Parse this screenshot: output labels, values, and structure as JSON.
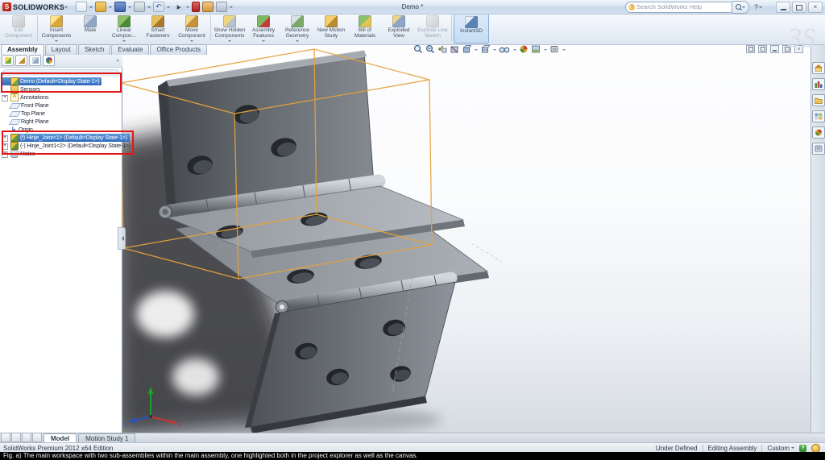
{
  "window": {
    "brand": "SOLIDWORKS",
    "title": "Demo *",
    "search_placeholder": "Search SolidWorks Help",
    "watermark": "3S"
  },
  "quick_access": {
    "icons": [
      "new-document",
      "open",
      "save",
      "print",
      "undo",
      "select-cursor",
      "rebuild",
      "options",
      "file-properties"
    ]
  },
  "command_manager": {
    "buttons": [
      {
        "label": "Edit Component",
        "disabled": true
      },
      {
        "label": "Insert Components",
        "dropdown": true
      },
      {
        "label": "Mate"
      },
      {
        "label": "Linear Compon...",
        "dropdown": true
      },
      {
        "label": "Smart Fasteners"
      },
      {
        "label": "Move Component",
        "dropdown": true
      },
      {
        "label": "Show Hidden Components",
        "dropdown": true
      },
      {
        "label": "Assembly Features",
        "dropdown": true
      },
      {
        "label": "Reference Geometry",
        "dropdown": true
      },
      {
        "label": "New Motion Study"
      },
      {
        "label": "Bill of Materials"
      },
      {
        "label": "Exploded View"
      },
      {
        "label": "Explode Line Sketch",
        "disabled": true
      },
      {
        "label": "Instant3D",
        "active": true
      }
    ]
  },
  "ribbon_tabs": {
    "active": "Assembly",
    "tabs": [
      {
        "label": "Assembly"
      },
      {
        "label": "Layout"
      },
      {
        "label": "Sketch"
      },
      {
        "label": "Evaluate"
      },
      {
        "label": "Office Products"
      }
    ]
  },
  "feature_tree": {
    "panel_tabs": [
      "featuremanager-tree",
      "propertymanager",
      "configurationmanager",
      "displaymanager"
    ],
    "overflow_chevron": "»",
    "items": [
      {
        "label": "Demo (Default<Display State-1>)",
        "icon": "assembly-icon",
        "selected": true,
        "red_boxed": true
      },
      {
        "label": "Sensors",
        "icon": "sensors-folder-icon"
      },
      {
        "label": "Annotations",
        "icon": "annotations-icon",
        "expandable": true
      },
      {
        "label": "Front Plane",
        "icon": "plane-icon"
      },
      {
        "label": "Top Plane",
        "icon": "plane-icon"
      },
      {
        "label": "Right Plane",
        "icon": "plane-icon"
      },
      {
        "label": "Origin",
        "icon": "origin-icon"
      },
      {
        "label": "(f) Hinje_Joint<1> (Default<Display State-1>)",
        "icon": "sub-assembly-icon",
        "selected": true,
        "expandable": true,
        "red_boxed": true
      },
      {
        "label": "(-) Hinje_Joint1<2> (Default<Display State-1>)",
        "icon": "sub-assembly-icon",
        "expandable": true,
        "red_boxed": true
      },
      {
        "label": "Mates",
        "icon": "mates-icon",
        "expandable": true
      }
    ]
  },
  "heads_up_toolbar": {
    "icons": [
      "zoom-to-fit",
      "zoom-to-area",
      "previous-view",
      "section-view",
      "view-orientation",
      "display-style",
      "hide-show-items",
      "edit-appearance",
      "apply-scene",
      "view-settings"
    ]
  },
  "task_pane": {
    "icons": [
      "solidworks-resources",
      "design-library",
      "file-explorer",
      "view-palette",
      "appearances-scenes",
      "custom-properties"
    ]
  },
  "viewport": {
    "selection_box_color": "#e6a23c",
    "triad_axes": [
      {
        "axis": "Y",
        "color": "#1fa02a"
      },
      {
        "axis": "X",
        "color": "#c63434"
      },
      {
        "axis": "Z",
        "color": "#2a52be"
      }
    ]
  },
  "bottom_tabs": {
    "active": "Model",
    "tabs": [
      {
        "label": "Model"
      },
      {
        "label": "Motion Study 1"
      }
    ]
  },
  "status_bar": {
    "product": "SolidWorks Premium 2012 x64 Edition",
    "constraint_status": "Under Defined",
    "mode": "Editing Assembly",
    "config": "Custom"
  },
  "caption": {
    "text": "Fig. a) The main workspace with two sub-assemblies within the main assembly, one highlighted both in the project explorer as well as the canvas."
  },
  "colors": {
    "selection_blue": "#2e6abf",
    "highlight_red": "#e21616",
    "bounding_box_orange": "#e6a23c",
    "model_dark_gray": "#5c6166",
    "model_light_gray": "#b3b9bf"
  }
}
